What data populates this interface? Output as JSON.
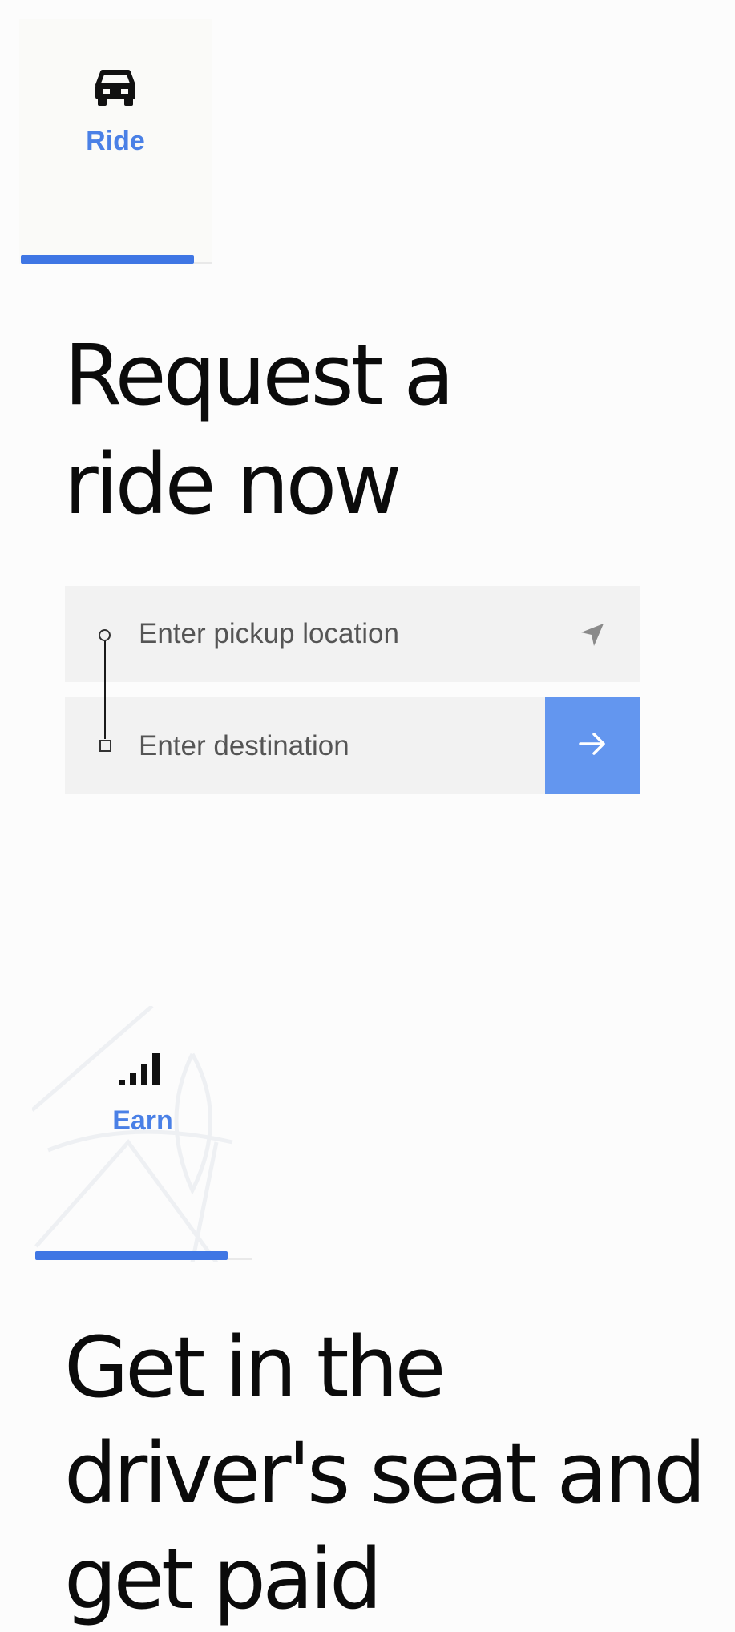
{
  "ride_tab": {
    "label": "Ride",
    "icon": "car-icon",
    "active_color": "#3f76e4"
  },
  "ride_section": {
    "heading_line1": "Request a",
    "heading_line2": "ride now",
    "pickup": {
      "placeholder": "Enter pickup location",
      "value": "",
      "icon": "location-arrow-icon"
    },
    "destination": {
      "placeholder": "Enter destination",
      "value": "",
      "submit_icon": "arrow-right-icon",
      "submit_color": "#6396ef"
    }
  },
  "earn_tab": {
    "label": "Earn",
    "icon": "signal-bars-icon",
    "active_color": "#3f76e4"
  },
  "earn_section": {
    "heading_line1": "Get in the",
    "heading_line2": "driver's seat and",
    "heading_line3": "get paid"
  }
}
